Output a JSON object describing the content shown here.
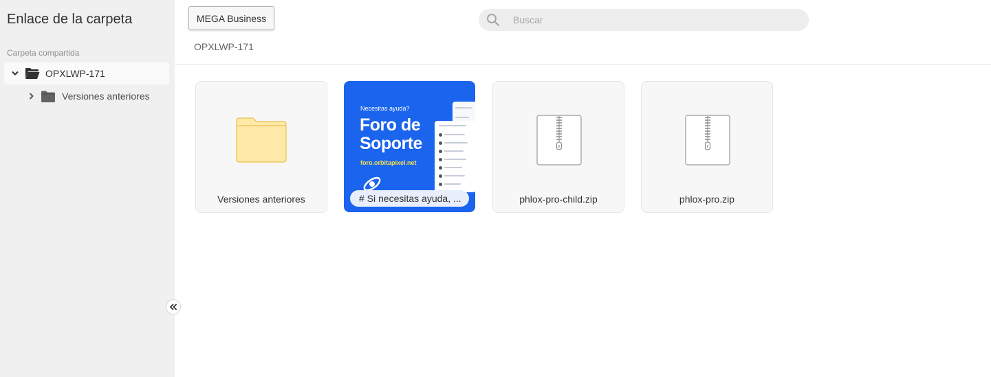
{
  "sidebar": {
    "title": "Enlace de la carpeta",
    "section_label": "Carpeta compartida",
    "tree": {
      "root_label": "OPXLWP-171",
      "child_label": "Versiones anteriores"
    }
  },
  "header": {
    "mega_button": "MEGA Business",
    "search_placeholder": "Buscar",
    "breadcrumb": "OPXLWP-171"
  },
  "items": [
    {
      "name": "Versiones anteriores",
      "type": "folder"
    },
    {
      "name": "# Si necesitas ayuda, ...",
      "type": "image",
      "thumb_small": "Necesitas ayuda?",
      "thumb_line1": "Foro de",
      "thumb_line2": "Soporte",
      "thumb_url": "foro.orbitapixel.net"
    },
    {
      "name": "phlox-pro-child.zip",
      "type": "zip"
    },
    {
      "name": "phlox-pro.zip",
      "type": "zip"
    }
  ],
  "colors": {
    "sidebar_bg": "#f0f0f0",
    "thumb_blue": "#1a64ee",
    "folder_yellow": "#ffe9a8",
    "thumb_accent": "#f4e04d"
  }
}
